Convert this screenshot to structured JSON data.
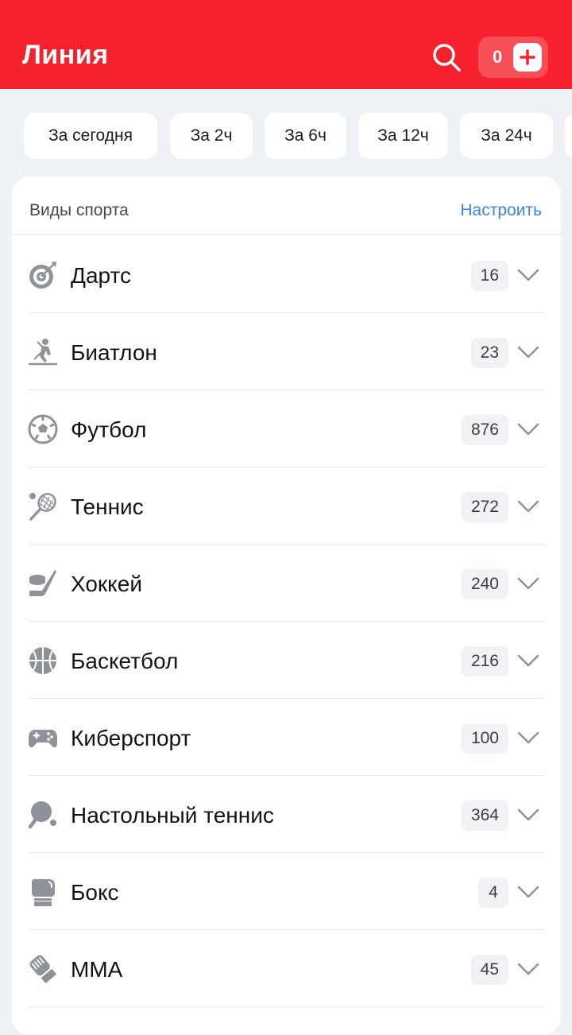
{
  "header": {
    "title": "Линия",
    "balance": "0",
    "icons": {
      "search": "search-icon",
      "add": "plus-icon"
    },
    "colors": {
      "brand": "#f5222d",
      "link": "#3d86d8"
    }
  },
  "filters": [
    {
      "label": "За сегодня"
    },
    {
      "label": "За 2ч"
    },
    {
      "label": "За 6ч"
    },
    {
      "label": "За 12ч"
    },
    {
      "label": "За 24ч"
    }
  ],
  "sports": {
    "title": "Виды спорта",
    "action": "Настроить",
    "items": [
      {
        "label": "Дартс",
        "count": "16",
        "icon": "darts-icon"
      },
      {
        "label": "Биатлон",
        "count": "23",
        "icon": "biathlon-icon"
      },
      {
        "label": "Футбол",
        "count": "876",
        "icon": "football-icon"
      },
      {
        "label": "Теннис",
        "count": "272",
        "icon": "tennis-icon"
      },
      {
        "label": "Хоккей",
        "count": "240",
        "icon": "hockey-icon"
      },
      {
        "label": "Баскетбол",
        "count": "216",
        "icon": "basketball-icon"
      },
      {
        "label": "Киберспорт",
        "count": "100",
        "icon": "gamepad-icon"
      },
      {
        "label": "Настольный теннис",
        "count": "364",
        "icon": "table-tennis-icon"
      },
      {
        "label": "Бокс",
        "count": "4",
        "icon": "boxing-glove-icon"
      },
      {
        "label": "MMA",
        "count": "45",
        "icon": "mma-glove-icon"
      }
    ]
  }
}
